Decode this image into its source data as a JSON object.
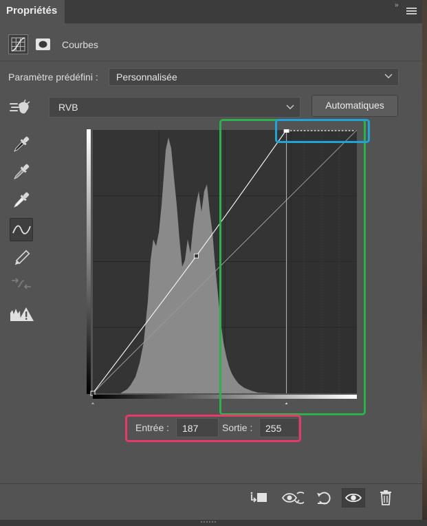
{
  "tab": {
    "title": "Propriétés",
    "collapse": "»",
    "menu_icon": "hamburger-menu-icon"
  },
  "header": {
    "panel_name": "Courbes",
    "icons": [
      "curves-adjustment-icon",
      "layer-mask-icon"
    ]
  },
  "preset": {
    "label": "Paramètre prédéfini :",
    "value": "Personnalisée"
  },
  "channel": {
    "value": "RVB"
  },
  "auto_button": {
    "label": "Automatiques"
  },
  "tools": [
    "on-image-adjustment-icon",
    "black-point-eyedropper-icon",
    "gray-point-eyedropper-icon",
    "white-point-eyedropper-icon",
    "edit-points-curve-icon",
    "draw-curve-pencil-icon",
    "smooth-curve-icon",
    "clipping-warning-icon"
  ],
  "curve": {
    "points": [
      [
        0,
        0
      ],
      [
        100,
        133
      ],
      [
        187,
        255
      ]
    ],
    "baseline": [
      [
        0,
        0
      ],
      [
        255,
        255
      ]
    ],
    "input_range": [
      0,
      255
    ],
    "output_range": [
      0,
      255
    ],
    "black_slider": 0,
    "white_slider": 187
  },
  "io": {
    "entree_label": "Entrée :",
    "entree_value": "187",
    "sortie_label": "Sortie :",
    "sortie_value": "255"
  },
  "bottom_bar": [
    "clip-to-layer-icon",
    "view-previous-state-icon",
    "reset-icon",
    "toggle-visibility-icon",
    "delete-icon"
  ],
  "colors": {
    "highlight_red": "#e8396a",
    "highlight_green": "#2bb24c",
    "highlight_blue": "#20a4d8"
  }
}
